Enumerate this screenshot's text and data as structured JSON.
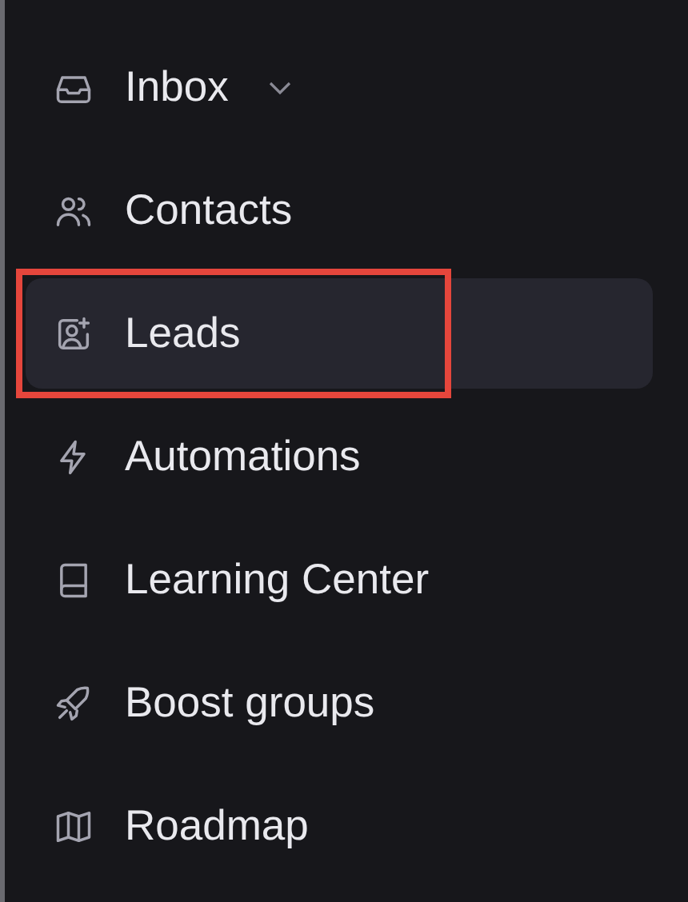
{
  "sidebar": {
    "items": [
      {
        "label": "Inbox",
        "kind": "dropdown",
        "selected": false,
        "annotated": false
      },
      {
        "label": "Contacts",
        "kind": "link",
        "selected": false,
        "annotated": false
      },
      {
        "label": "Leads",
        "kind": "link",
        "selected": true,
        "annotated": true
      },
      {
        "label": "Automations",
        "kind": "link",
        "selected": false,
        "annotated": false
      },
      {
        "label": "Learning Center",
        "kind": "link",
        "selected": false,
        "annotated": false
      },
      {
        "label": "Boost groups",
        "kind": "link",
        "selected": false,
        "annotated": false
      },
      {
        "label": "Roadmap",
        "kind": "link",
        "selected": false,
        "annotated": false
      }
    ]
  }
}
